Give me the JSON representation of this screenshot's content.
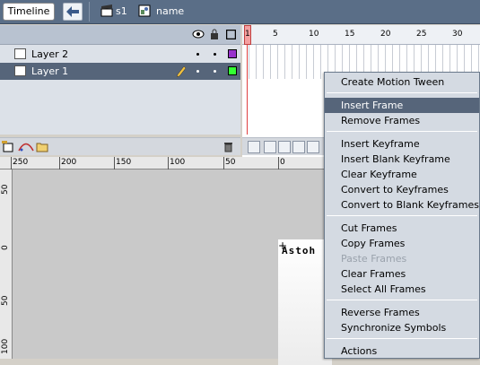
{
  "topbar": {
    "timeline_label": "Timeline",
    "crumbs": [
      "s1",
      "name"
    ]
  },
  "layers": [
    {
      "name": "Layer 2",
      "color": "#9933cc",
      "selected": false
    },
    {
      "name": "Layer 1",
      "color": "#33ff33",
      "selected": true
    }
  ],
  "frame_numbers": [
    "1",
    "5",
    "10",
    "15",
    "20",
    "25",
    "30"
  ],
  "rulers": {
    "horizontal": [
      "250",
      "200",
      "150",
      "100",
      "50",
      "0"
    ],
    "vertical": [
      "50",
      "0",
      "50",
      "100"
    ]
  },
  "stage": {
    "text": "Astoh"
  },
  "context_menu": {
    "groups": [
      [
        {
          "label": "Create Motion Tween",
          "state": "normal"
        }
      ],
      [
        {
          "label": "Insert Frame",
          "state": "selected"
        },
        {
          "label": "Remove Frames",
          "state": "normal"
        }
      ],
      [
        {
          "label": "Insert Keyframe",
          "state": "normal"
        },
        {
          "label": "Insert Blank Keyframe",
          "state": "normal"
        },
        {
          "label": "Clear Keyframe",
          "state": "normal"
        },
        {
          "label": "Convert to Keyframes",
          "state": "normal"
        },
        {
          "label": "Convert to Blank Keyframes",
          "state": "normal"
        }
      ],
      [
        {
          "label": "Cut Frames",
          "state": "normal"
        },
        {
          "label": "Copy Frames",
          "state": "normal"
        },
        {
          "label": "Paste Frames",
          "state": "disabled"
        },
        {
          "label": "Clear Frames",
          "state": "normal"
        },
        {
          "label": "Select All Frames",
          "state": "normal"
        }
      ],
      [
        {
          "label": "Reverse Frames",
          "state": "normal"
        },
        {
          "label": "Synchronize Symbols",
          "state": "normal"
        }
      ],
      [
        {
          "label": "Actions",
          "state": "normal"
        }
      ]
    ]
  },
  "icons": {
    "back": "arrow-left-icon",
    "scene": "clapper-icon",
    "symbol": "graphic-symbol-icon",
    "eye": "eye-icon",
    "lock": "lock-icon",
    "outline": "outline-square-icon",
    "pencil": "pencil-icon",
    "trash": "trash-icon"
  }
}
